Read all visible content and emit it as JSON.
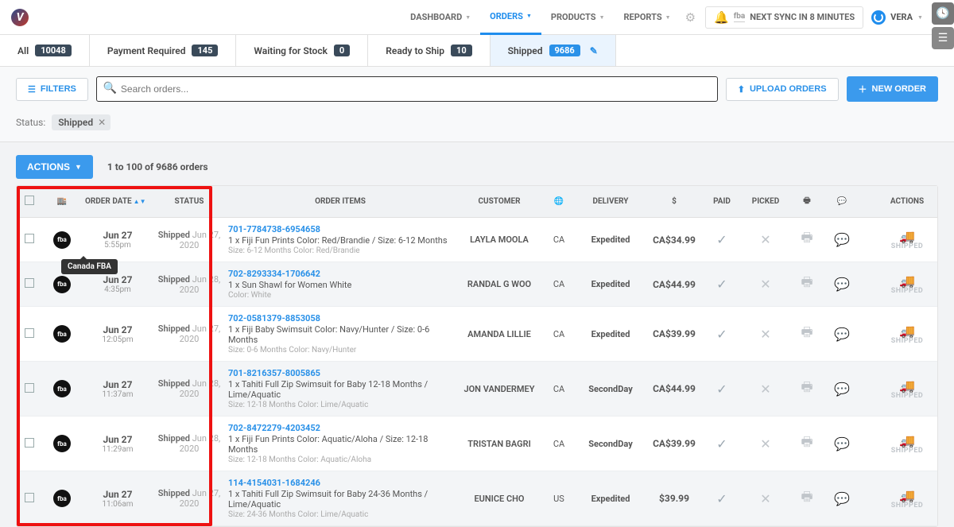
{
  "nav": {
    "items": [
      "DASHBOARD",
      "ORDERS",
      "PRODUCTS",
      "REPORTS"
    ],
    "active": 1,
    "sync_text": "NEXT SYNC IN 8 MINUTES",
    "user": "VERA"
  },
  "status_tabs": [
    {
      "label": "All",
      "count": "10048"
    },
    {
      "label": "Payment Required",
      "count": "145"
    },
    {
      "label": "Waiting for Stock",
      "count": "0"
    },
    {
      "label": "Ready to Ship",
      "count": "10"
    },
    {
      "label": "Shipped",
      "count": "9686",
      "active": true,
      "editable": true
    }
  ],
  "toolbar": {
    "filters_label": "FILTERS",
    "search_placeholder": "Search orders...",
    "upload_label": "UPLOAD ORDERS",
    "new_order_label": "NEW ORDER"
  },
  "filter_chip": {
    "field": "Status:",
    "value": "Shipped"
  },
  "actions": {
    "button": "ACTIONS",
    "count_text": "1 to 100 of 9686 orders"
  },
  "table": {
    "headers": {
      "order_date": "ORDER DATE",
      "status": "STATUS",
      "order_items": "ORDER ITEMS",
      "customer": "CUSTOMER",
      "delivery": "DELIVERY",
      "price": "$",
      "paid": "PAID",
      "picked": "PICKED",
      "actions": "ACTIONS"
    },
    "rows": [
      {
        "date": "Jun 27",
        "time": "5:55pm",
        "status": "Shipped",
        "status_date": "Jun 27, 2020",
        "order_num": "701-7784738-6954658",
        "desc": "1 x Fiji Fun Prints Color: Red/Brandie / Size: 6-12 Months",
        "meta": "Size: 6-12 Months   Color: Red/Brandie",
        "customer": "LAYLA MOOLA",
        "country": "CA",
        "delivery": "Expedited",
        "price": "CA$34.99"
      },
      {
        "date": "Jun 27",
        "time": "4:35pm",
        "status": "Shipped",
        "status_date": "Jun 28, 2020",
        "order_num": "702-8293334-1706642",
        "desc": "1 x Sun Shawl for Women White",
        "meta": "Color: White",
        "customer": "RANDAL G WOO",
        "country": "CA",
        "delivery": "Expedited",
        "price": "CA$44.99"
      },
      {
        "date": "Jun 27",
        "time": "12:05pm",
        "status": "Shipped",
        "status_date": "Jun 27, 2020",
        "order_num": "702-0581379-8853058",
        "desc": "1 x Fiji Baby Swimsuit Color: Navy/Hunter / Size: 0-6 Months",
        "meta": "Size: 0-6 Months   Color: Navy/Hunter",
        "customer": "AMANDA LILLIE",
        "country": "CA",
        "delivery": "Expedited",
        "price": "CA$39.99"
      },
      {
        "date": "Jun 27",
        "time": "11:37am",
        "status": "Shipped",
        "status_date": "Jun 28, 2020",
        "order_num": "701-8216357-8005865",
        "desc": "1 x Tahiti Full Zip Swimsuit for Baby 12-18 Months / Lime/Aquatic",
        "meta": "Size: 12-18 Months   Color: Lime/Aquatic",
        "customer": "JON VANDERMEY",
        "country": "CA",
        "delivery": "SecondDay",
        "price": "CA$44.99"
      },
      {
        "date": "Jun 27",
        "time": "11:29am",
        "status": "Shipped",
        "status_date": "Jun 28, 2020",
        "order_num": "702-8472279-4203452",
        "desc": "1 x Fiji Fun Prints Color: Aquatic/Aloha / Size: 12-18 Months",
        "meta": "Size: 12-18 Months   Color: Aquatic/Aloha",
        "customer": "TRISTAN BAGRI",
        "country": "CA",
        "delivery": "SecondDay",
        "price": "CA$39.99"
      },
      {
        "date": "Jun 27",
        "time": "11:06am",
        "status": "Shipped",
        "status_date": "Jun 27, 2020",
        "order_num": "114-4154031-1684246",
        "desc": "1 x Tahiti Full Zip Swimsuit for Baby 24-36 Months / Lime/Aquatic",
        "meta": "Size: 24-36 Months   Color: Lime/Aquatic",
        "customer": "EUNICE CHO",
        "country": "US",
        "delivery": "Expedited",
        "price": "$39.99"
      }
    ],
    "shipped_label": "SHIPPED"
  },
  "tooltip": "Canada FBA",
  "store_badge": "fba"
}
